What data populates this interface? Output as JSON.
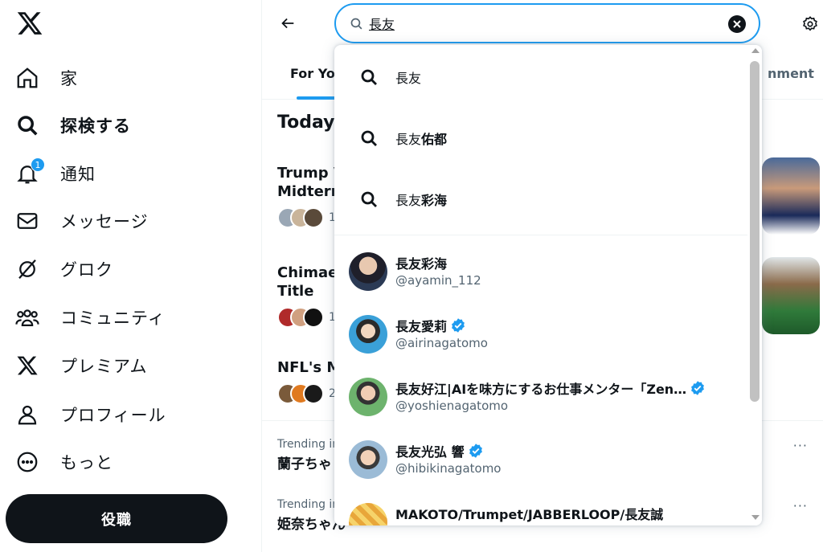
{
  "sidebar": {
    "items": [
      {
        "label": "家",
        "icon": "home-icon"
      },
      {
        "label": "探検する",
        "icon": "search-icon"
      },
      {
        "label": "通知",
        "icon": "bell-icon",
        "badge": "1"
      },
      {
        "label": "メッセージ",
        "icon": "envelope-icon"
      },
      {
        "label": "グロク",
        "icon": "grok-icon"
      },
      {
        "label": "コミュニティ",
        "icon": "people-icon"
      },
      {
        "label": "プレミアム",
        "icon": "x-logo-icon"
      },
      {
        "label": "プロフィール",
        "icon": "person-icon"
      },
      {
        "label": "もっと",
        "icon": "more-circle-icon"
      }
    ],
    "post_label": "役職"
  },
  "search": {
    "value": "長友"
  },
  "tabs": [
    {
      "label": "For You"
    },
    {
      "label": "nment"
    }
  ],
  "main": {
    "section_title": "Today",
    "stories": [
      {
        "title_line1": "Trump V",
        "title_line2": "Midterm",
        "count": "1"
      },
      {
        "title_line1": "Chimae",
        "title_line2": "Title",
        "count": "1"
      },
      {
        "title_line1": "NFL's M",
        "title_line2": "",
        "count": "2"
      }
    ],
    "trends": [
      {
        "meta": "Trending in",
        "name": "蘭子ちゃ",
        "more": "···"
      },
      {
        "meta": "Trending in",
        "name": "姫奈ちゃん",
        "more": "···"
      }
    ]
  },
  "dropdown": {
    "queries": [
      {
        "prefix": "長友",
        "suffix": ""
      },
      {
        "prefix": "長友",
        "suffix": "佑都"
      },
      {
        "prefix": "長友",
        "suffix": "彩海"
      }
    ],
    "users": [
      {
        "name": "長友彩海",
        "handle": "@ayamin_112",
        "verified": false,
        "avatar_color": "#2b3a55"
      },
      {
        "name": "長友愛莉",
        "handle": "@airinagatomo",
        "verified": true,
        "avatar_color": "#3aa0d8"
      },
      {
        "name": "長友好江|AIを味方にするお仕事メンター「Zen…",
        "handle": "@yoshienagatomo",
        "verified": true,
        "avatar_color": "#6db36d"
      },
      {
        "name": "長友光弘 響",
        "handle": "@hibikinagatomo",
        "verified": true,
        "avatar_color": "#9bbbd6"
      },
      {
        "name": "MAKOTO/Trumpet/JABBERLOOP/長友誠",
        "handle": "",
        "verified": false,
        "avatar_color": "#e8a63a"
      }
    ]
  },
  "colors": {
    "accent": "#1d9bf0",
    "text": "#0f1419",
    "muted": "#536471"
  }
}
